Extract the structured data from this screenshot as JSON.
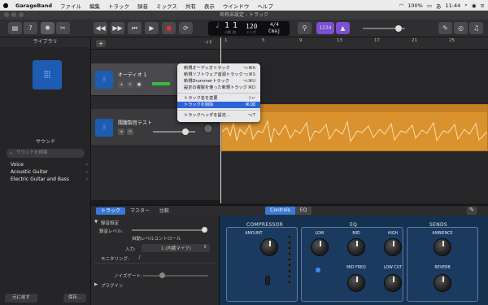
{
  "menubar": {
    "app_name": "GarageBand",
    "items": [
      "ファイル",
      "編集",
      "トラック",
      "録音",
      "ミックス",
      "共有",
      "表示",
      "ウインドウ",
      "ヘルプ"
    ],
    "battery": "100%",
    "clock": "11:44"
  },
  "window": {
    "title": "名称未設定 - トラック"
  },
  "toolbar": {
    "lcd": {
      "bar": "1",
      "beat": "1",
      "bar_label": "小節",
      "beat_label": "拍",
      "tempo": "120",
      "tempo_label": "テンポ",
      "signature": "4/4",
      "key": "Cmaj"
    },
    "count_in": "1234"
  },
  "library": {
    "header": "ライブラリ",
    "sound_header": "サウンド",
    "search_placeholder": "サウンドを検索",
    "items": [
      {
        "label": "Voice"
      },
      {
        "label": "Acoustic Guitar"
      },
      {
        "label": "Electric Guitar and Bass"
      }
    ],
    "revert_button": "元に戻す",
    "save_button": "保存..."
  },
  "tracks": [
    {
      "name": "オーディオ 1"
    },
    {
      "name": "闊腹製音テスト"
    }
  ],
  "ruler": {
    "marks": [
      "1",
      "5",
      "9",
      "13",
      "17",
      "21",
      "25"
    ]
  },
  "context_menu": {
    "items": [
      {
        "label": "新規オーディオトラック",
        "shortcut": "⌥⌘A"
      },
      {
        "label": "新規ソフトウェア音源トラック",
        "shortcut": "⌥⌘S"
      },
      {
        "label": "新規Drummerトラック",
        "shortcut": "⌥⌘U"
      },
      {
        "label": "設定の複製を使った新規トラック",
        "shortcut": "⌘D"
      },
      {
        "label": "トラック名を変更",
        "shortcut": "⇧↩"
      },
      {
        "label": "トラックを削除",
        "shortcut": "⌘⌫"
      },
      {
        "label": "トラックヘッダを設定...",
        "shortcut": "⌥T"
      }
    ]
  },
  "editor": {
    "tabs": [
      "トラック",
      "マスター",
      "比較"
    ],
    "inspector": {
      "recording_settings": "録音設定",
      "record_level": "録音レベル:",
      "auto_level": "自動レベルコントロール",
      "input_label": "入力:",
      "input_value": "1 (内蔵マイク)",
      "monitoring": "モニタリング:",
      "noise_gate": "ノイズゲート:",
      "plugins": "プラグイン"
    }
  },
  "smart_controls": {
    "tabs": [
      "Controls",
      "EQ"
    ],
    "compressor": {
      "title": "COMPRESSOR",
      "amount": "AMOUNT"
    },
    "eq": {
      "title": "EQ",
      "low": "LOW",
      "mid": "MID",
      "high": "HIGH",
      "mid_freq": "MID FREQ",
      "low_cut": "LOW CUT"
    },
    "sends": {
      "title": "SENDS",
      "ambience": "AMBIENCE",
      "reverb": "REVERB"
    }
  },
  "colors": {
    "region": "#d9922e",
    "track_icon": "#1e5bb3",
    "highlight": "#2c64d8",
    "smart_bg": "#16314f"
  }
}
